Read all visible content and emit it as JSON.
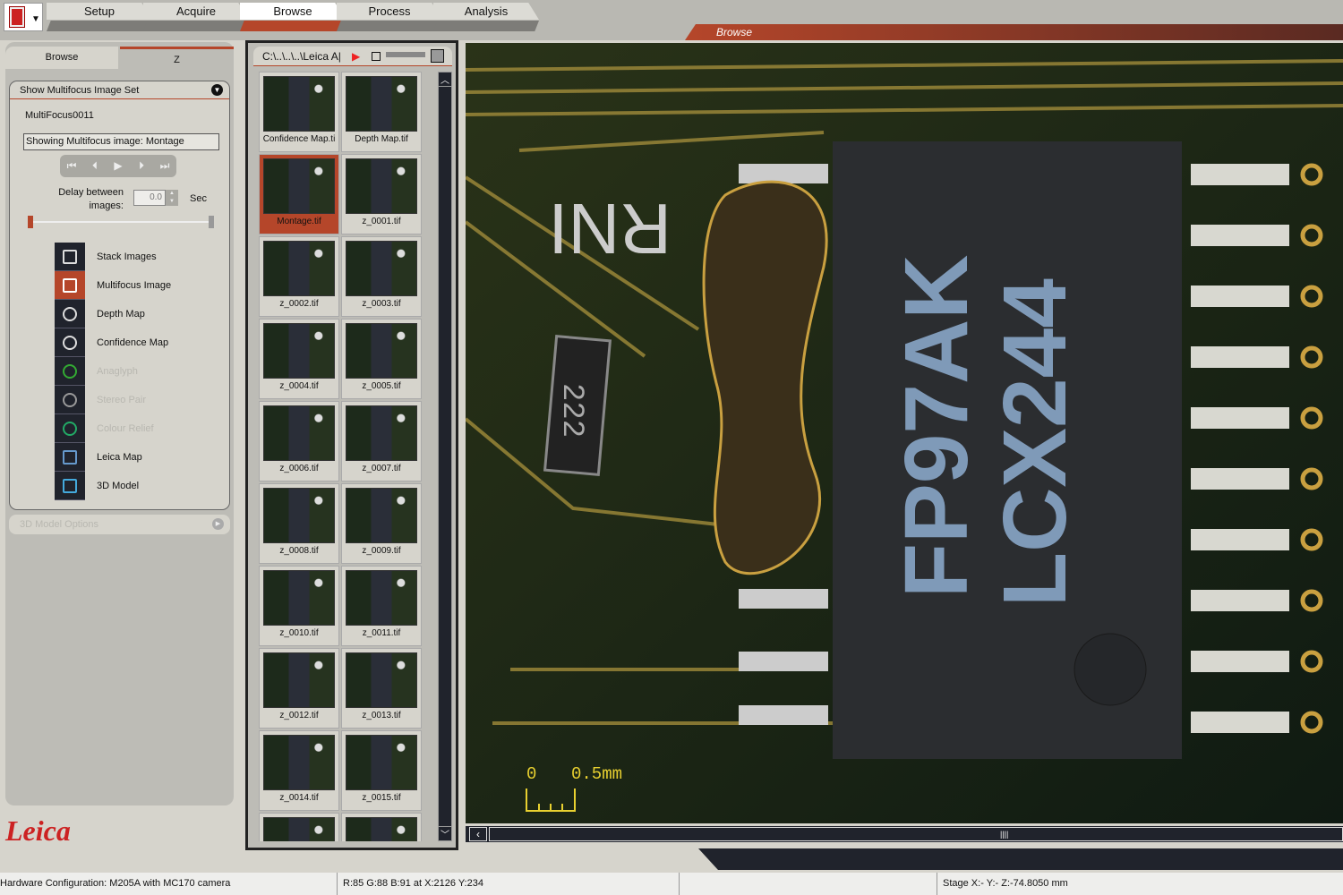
{
  "nav": {
    "tabs": [
      {
        "label": "Setup"
      },
      {
        "label": "Acquire"
      },
      {
        "label": "Browse",
        "active": true
      },
      {
        "label": "Process"
      },
      {
        "label": "Analysis"
      }
    ],
    "banner": "Browse"
  },
  "left": {
    "tabs": [
      "Browse",
      "Z"
    ],
    "group_title": "Show Multifocus Image Set",
    "set_name": "MultiFocus0011",
    "status_field": "Showing Multifocus image: Montage",
    "delay_label": "Delay between images:",
    "delay_value": "0.0",
    "delay_unit": "Sec",
    "items": [
      {
        "label": "Stack Images",
        "icon": "stack-images-icon",
        "enabled": true
      },
      {
        "label": "Multifocus Image",
        "icon": "multifocus-icon",
        "enabled": true,
        "active": true
      },
      {
        "label": "Depth Map",
        "icon": "depth-map-icon",
        "enabled": true
      },
      {
        "label": "Confidence Map",
        "icon": "confidence-map-icon",
        "enabled": true
      },
      {
        "label": "Anaglyph",
        "icon": "anaglyph-icon",
        "enabled": false
      },
      {
        "label": "Stereo Pair",
        "icon": "stereo-pair-icon",
        "enabled": false
      },
      {
        "label": "Colour Relief",
        "icon": "colour-relief-icon",
        "enabled": false
      },
      {
        "label": "Leica Map",
        "icon": "leica-map-icon",
        "enabled": true
      },
      {
        "label": "3D Model",
        "icon": "3d-model-icon",
        "enabled": true
      }
    ],
    "options_title": "3D Model Options",
    "logo": "Leica"
  },
  "thumbs": {
    "path": "C:\\..\\..\\..\\Leica A|",
    "files": [
      "Confidence Map.ti",
      "Depth Map.tif",
      "Montage.tif",
      "z_0001.tif",
      "z_0002.tif",
      "z_0003.tif",
      "z_0004.tif",
      "z_0005.tif",
      "z_0006.tif",
      "z_0007.tif",
      "z_0008.tif",
      "z_0009.tif",
      "z_0010.tif",
      "z_0011.tif",
      "z_0012.tif",
      "z_0013.tif",
      "z_0014.tif",
      "z_0015.tif",
      "",
      ""
    ],
    "selected": "Montage.tif"
  },
  "viewer": {
    "chip_text_1": "FP97AK",
    "chip_text_2": "LCX244",
    "resistor_text": "222",
    "silk_text": "RNI",
    "scale_zero": "0",
    "scale_label": "0.5mm"
  },
  "status": {
    "hardware": "Hardware Configuration: M205A with MC170 camera",
    "pixel": "R:85  G:88  B:91  at  X:2126  Y:234",
    "stage": "Stage X:-  Y:-  Z:-74.8050 mm"
  },
  "colors": {
    "accent": "#b5462a",
    "dark": "#20232c",
    "panel": "#d6d4cc"
  }
}
